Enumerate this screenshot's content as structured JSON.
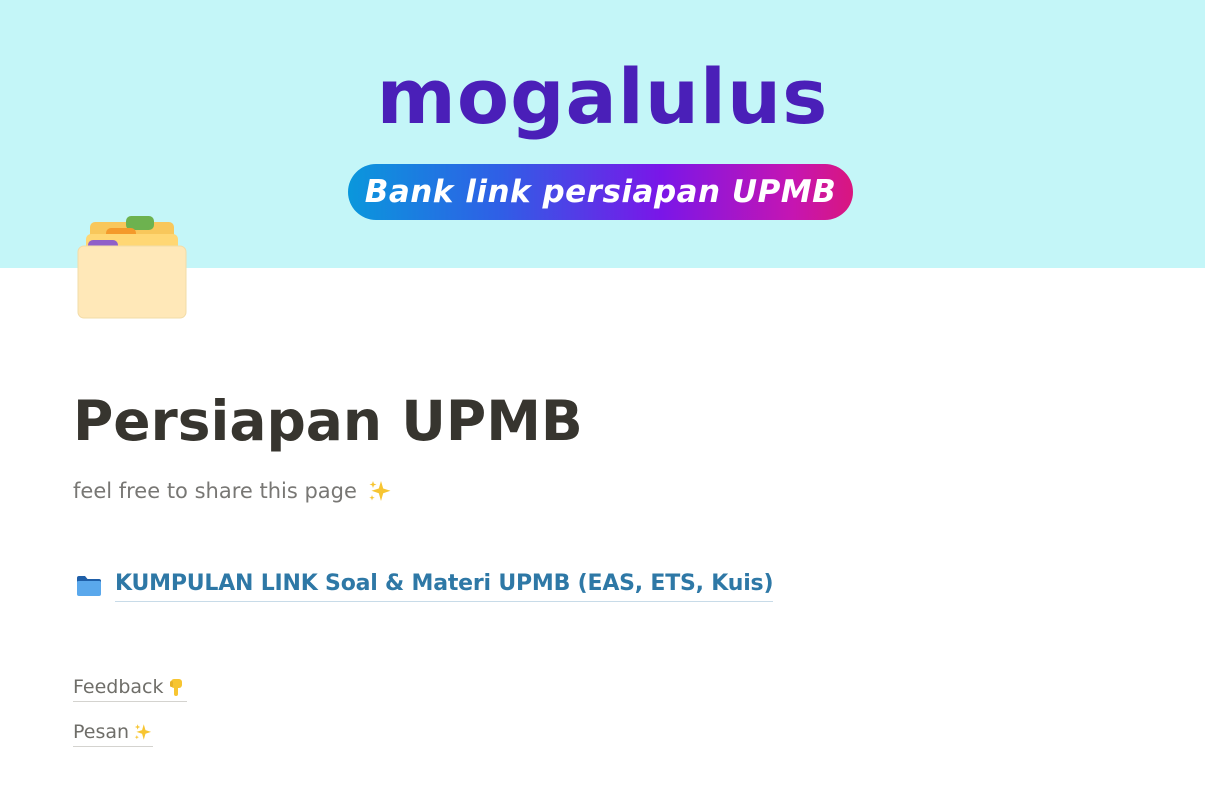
{
  "cover": {
    "background": "#c4f6f8",
    "brand_title": "mogalulus",
    "brand_color": "#4a1fb8",
    "pill_text": "Bank link persiapan UPMB"
  },
  "page_icon": "card-index-dividers-icon",
  "page": {
    "title": "Persiapan UPMB",
    "subtitle": "feel free to share this page",
    "subtitle_icon": "sparkles-icon"
  },
  "links": {
    "main": {
      "icon": "folder-icon",
      "label": "KUMPULAN LINK Soal & Materi UPMB (EAS, ETS, Kuis)",
      "color": "#2e78a6"
    },
    "feedback": {
      "label": "Feedback",
      "icon": "pointing-down-icon"
    },
    "pesan": {
      "label": "Pesan",
      "icon": "sparkles-icon"
    }
  }
}
